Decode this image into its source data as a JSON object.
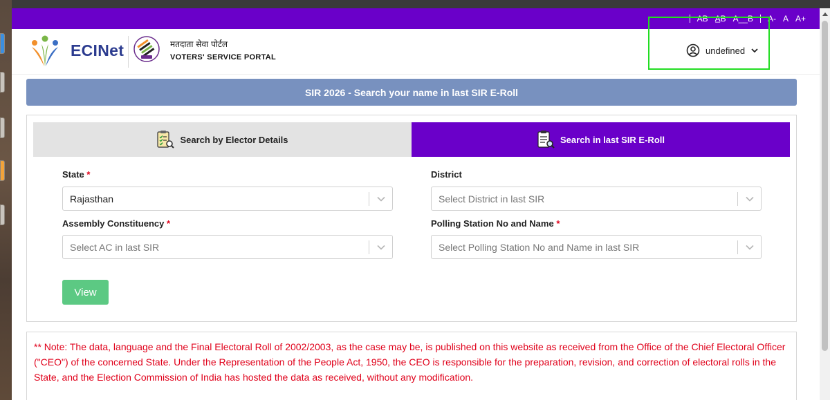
{
  "font_controls": [
    "AB",
    "A̲B",
    "A__B",
    "A-",
    "A",
    "A+"
  ],
  "header": {
    "brand": "ECINet",
    "portal_hindi": "मतदाता सेवा पोर्टल",
    "portal_english": "VOTERS' SERVICE PORTAL"
  },
  "user": {
    "name": "undefined"
  },
  "banner": {
    "text": "SIR 2026 - Search your name in last SIR E-Roll"
  },
  "tabs": [
    {
      "label": "Search by Elector Details",
      "active": false
    },
    {
      "label": "Search in last SIR E-Roll",
      "active": true
    }
  ],
  "form": {
    "required_mark": "*",
    "state": {
      "label": "State",
      "value": "Rajasthan"
    },
    "district": {
      "label": "District",
      "placeholder": "Select District in last SIR"
    },
    "ac": {
      "label": "Assembly Constituency",
      "placeholder": "Select AC in last SIR"
    },
    "ps": {
      "label": "Polling Station No and Name",
      "placeholder": "Select Polling Station No and Name in last SIR"
    },
    "view_label": "View"
  },
  "note": {
    "text": "** Note: The data, language and the Final Electoral Roll of 2002/2003, as the case may be, is published on this website as received from the Office of the Chief Electoral Officer (\"CEO\") of the concerned State. Under the Representation of the People Act, 1950, the CEO is responsible for the preparation, revision, and correction of electoral rolls in the State, and the Election Commission of India has hosted the data as received, without any modification."
  },
  "colors": {
    "purple": "#6a00c9",
    "banner": "#7891bf",
    "green_button": "#5cc983",
    "required_red": "#e0001a",
    "focus_outline": "#22dd22"
  }
}
